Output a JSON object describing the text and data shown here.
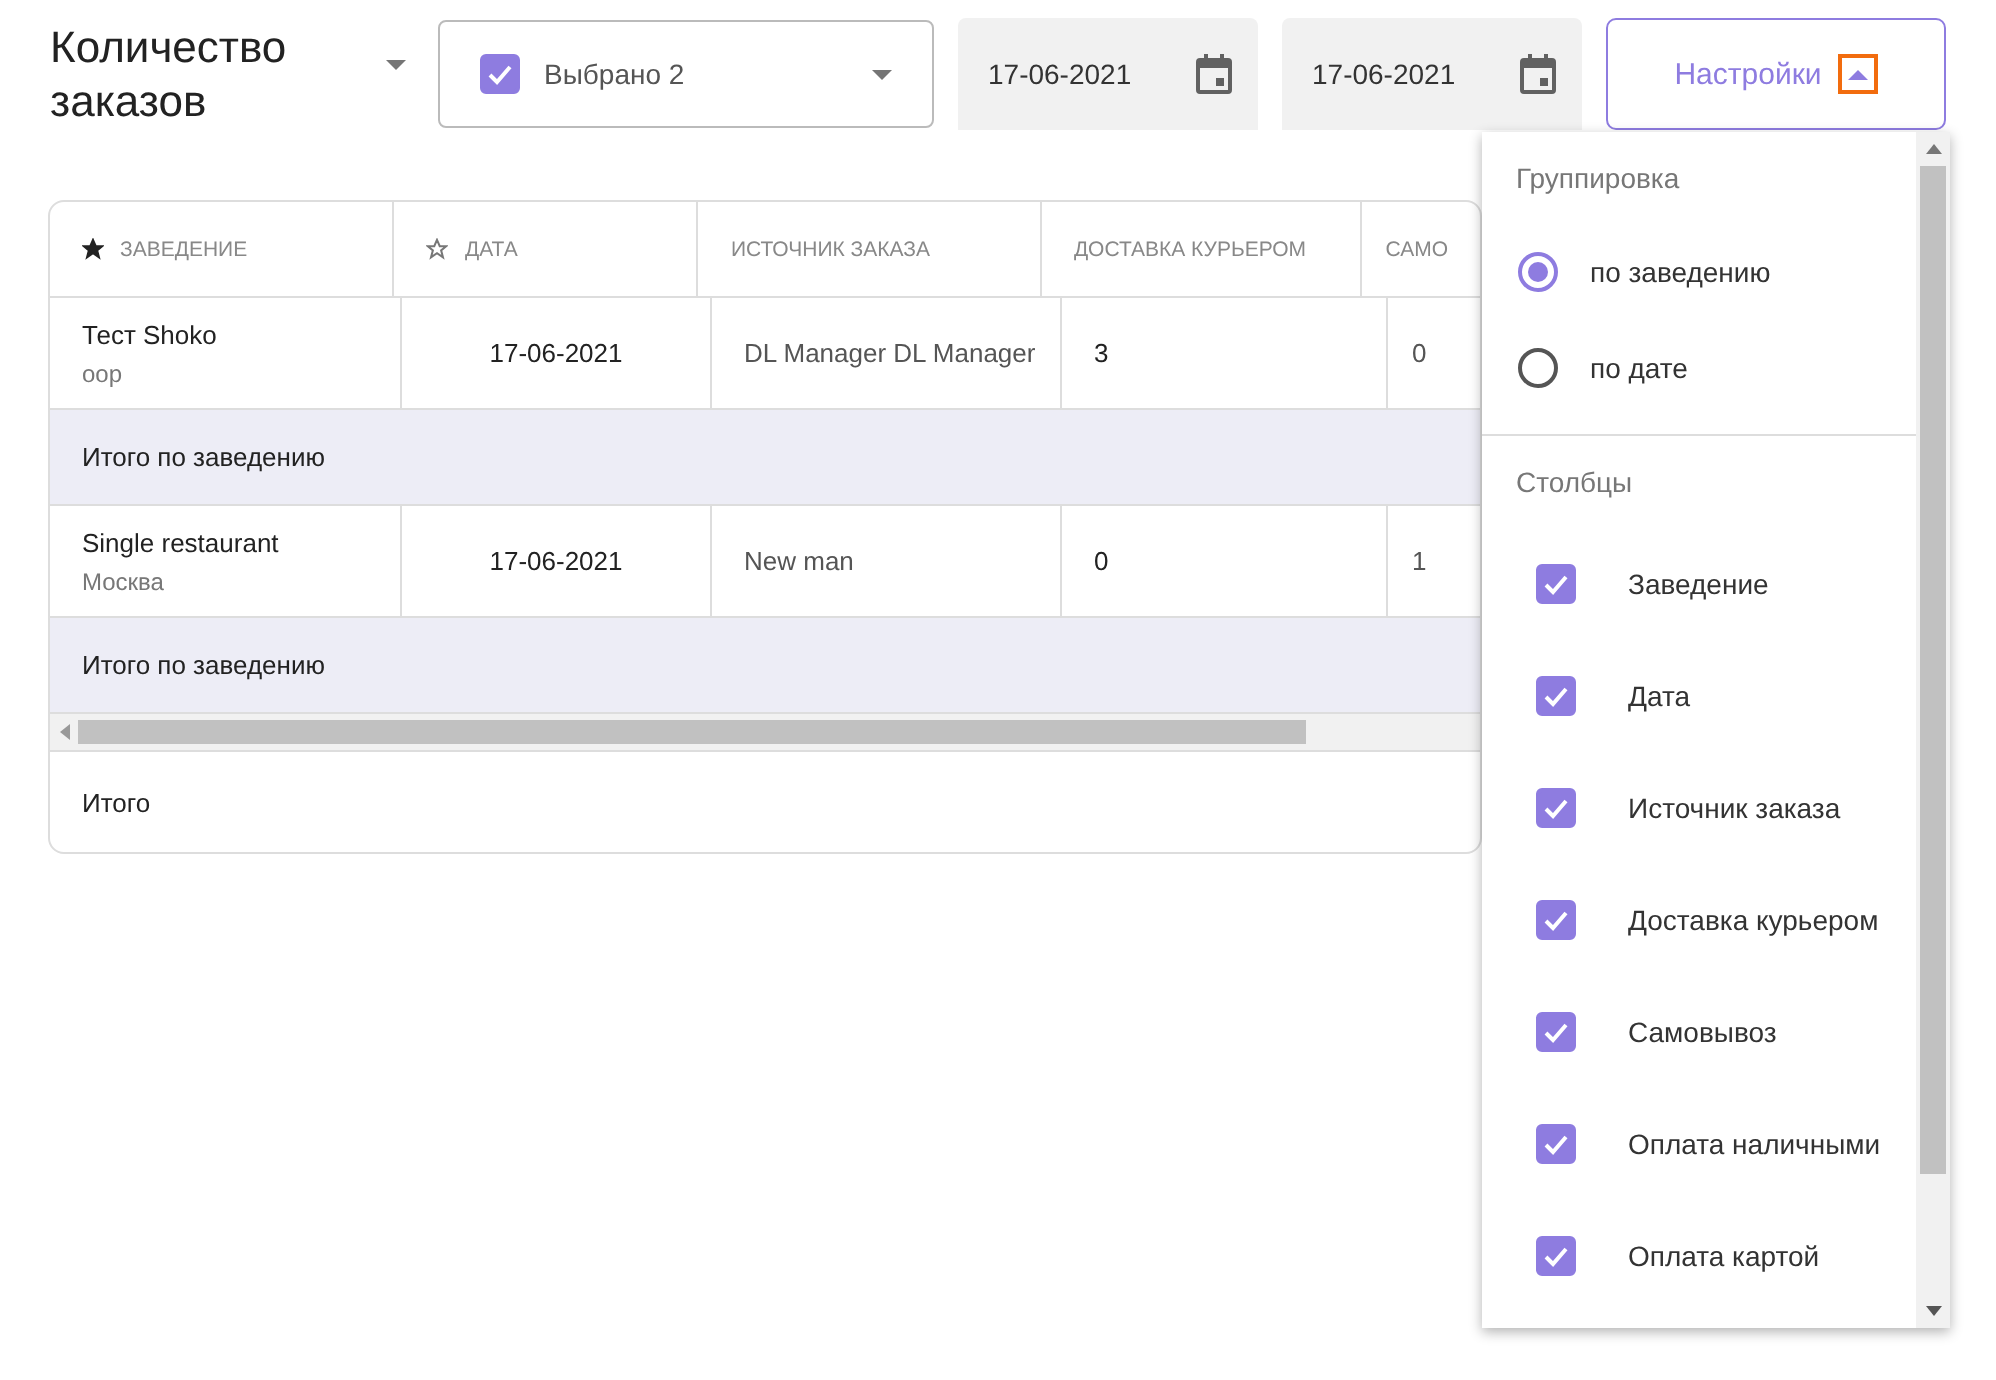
{
  "title": "Количество заказов",
  "select": {
    "checked": true,
    "value": "Выбрано 2"
  },
  "date_from": {
    "value": "17-06-2021"
  },
  "date_to": {
    "value": "17-06-2021"
  },
  "settings_button": {
    "label": "Настройки",
    "expanded": true
  },
  "table": {
    "columns": [
      {
        "label": "ЗАВЕДЕНИЕ",
        "starred": true
      },
      {
        "label": "ДАТА",
        "starred": false
      },
      {
        "label": "ИСТОЧНИК ЗАКАЗА"
      },
      {
        "label": "ДОСТАВКА КУРЬЕРОМ"
      },
      {
        "label": "САМО"
      }
    ],
    "rows": [
      {
        "kind": "row",
        "name": "Тест Shoko",
        "sub": "оор",
        "date": "17-06-2021",
        "source": "DL Manager DL Manager",
        "courier": "3",
        "pickup": "0"
      },
      {
        "kind": "subtotal",
        "label": "Итого по заведению"
      },
      {
        "kind": "row",
        "name": "Single restaurant",
        "sub": "Москва",
        "date": "17-06-2021",
        "source": "New man",
        "courier": "0",
        "pickup": "1"
      },
      {
        "kind": "subtotal",
        "label": "Итого по заведению"
      }
    ],
    "total": "Итого"
  },
  "settings_menu": {
    "grouping_title": "Группировка",
    "grouping": [
      {
        "label": "по заведению",
        "selected": true
      },
      {
        "label": "по дате",
        "selected": false
      }
    ],
    "columns_title": "Столбцы",
    "columns": [
      {
        "label": "Заведение",
        "checked": true
      },
      {
        "label": "Дата",
        "checked": true
      },
      {
        "label": "Источник заказа",
        "checked": true
      },
      {
        "label": "Доставка курьером",
        "checked": true
      },
      {
        "label": "Самовывоз",
        "checked": true
      },
      {
        "label": "Оплата наличными",
        "checked": true
      },
      {
        "label": "Оплата картой",
        "checked": true
      }
    ]
  }
}
